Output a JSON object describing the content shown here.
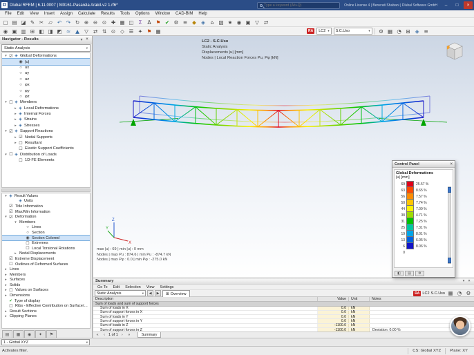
{
  "titlebar": {
    "app_title": "Dlubal RFEM | 6.11.0007 | M0161-Pasarela Arakil-v2 1.rf6*",
    "search_placeholder": "Type a keyword (Alt+Q)",
    "license_text": "Online License 4 | Benerati Shabani | Dlubal Software GmbH",
    "minimize": "–",
    "maximize": "□",
    "close": "×"
  },
  "menubar": {
    "items": [
      {
        "label": "File"
      },
      {
        "label": "Edit"
      },
      {
        "label": "View"
      },
      {
        "label": "Insert"
      },
      {
        "label": "Assign"
      },
      {
        "label": "Calculate"
      },
      {
        "label": "Results"
      },
      {
        "label": "Tools"
      },
      {
        "label": "Options"
      },
      {
        "label": "Window"
      },
      {
        "label": "CAD-BIM"
      },
      {
        "label": "Help"
      }
    ]
  },
  "toolbars": {
    "row1": [
      {
        "g": "▢"
      },
      {
        "g": "▤"
      },
      {
        "g": "◪"
      },
      {
        "g": "✎"
      },
      {
        "g": "✂"
      },
      {
        "g": "▱"
      },
      {
        "g": "↶",
        "c": "#3a6ea5"
      },
      {
        "g": "↷",
        "c": "#3a6ea5"
      },
      {
        "g": "↻"
      },
      {
        "g": "⊕"
      },
      {
        "g": "⊖"
      },
      {
        "g": "⊙"
      },
      {
        "g": "✚"
      },
      {
        "g": "▦"
      },
      {
        "g": "◫"
      },
      {
        "g": "Σ",
        "c": "#7a4aa5"
      },
      {
        "g": "Δ"
      },
      {
        "g": "⚑",
        "c": "#c04000"
      },
      {
        "g": "✔",
        "c": "#1da01d"
      },
      {
        "g": "⚙"
      },
      {
        "g": "≡"
      },
      {
        "g": "◆",
        "c": "#b8860b"
      },
      {
        "g": "◈",
        "c": "#3a6ea5"
      },
      {
        "g": "⌂"
      },
      {
        "g": "▧"
      },
      {
        "g": "★"
      },
      {
        "g": "◉"
      },
      {
        "g": "▣"
      },
      {
        "g": "▽"
      },
      {
        "g": "⇄"
      }
    ],
    "row2": [
      {
        "g": "◉"
      },
      {
        "g": "▣"
      },
      {
        "g": "▥"
      },
      {
        "g": "⊞"
      },
      {
        "g": "◧"
      },
      {
        "g": "◨"
      },
      {
        "g": "◩"
      },
      {
        "g": "≈",
        "c": "#3a6ea5"
      },
      {
        "g": "▲",
        "c": "#3a6ea5"
      },
      {
        "g": "▽"
      },
      {
        "g": "⇄"
      },
      {
        "g": "⇅"
      },
      {
        "g": "⊙"
      },
      {
        "g": "◇"
      },
      {
        "g": "☰"
      },
      {
        "g": "✦"
      },
      {
        "g": "⚑",
        "c": "#c04000"
      },
      {
        "g": "▦"
      }
    ],
    "row2b": [
      {
        "g": "⚙"
      },
      {
        "g": "▦"
      },
      {
        "g": "◔"
      },
      {
        "g": "⊞"
      },
      {
        "g": "◈",
        "c": "#3a6ea5"
      },
      {
        "g": "≡"
      }
    ],
    "load_case": {
      "badge": "RA",
      "code": "LC2",
      "name": "S.C.Uso"
    }
  },
  "navigator": {
    "title": "Navigator - Results",
    "collapse": "▾",
    "close": "×",
    "combo": "Static Analysis",
    "tree1": [
      {
        "pad": "2px",
        "exp": "▾",
        "box": "☑",
        "ic": "◈",
        "label": "Global Deformations"
      },
      {
        "pad": "16px",
        "box": "◉",
        "label": "|u|",
        "cls": "sel"
      },
      {
        "pad": "16px",
        "box": "○",
        "label": "ux"
      },
      {
        "pad": "16px",
        "box": "○",
        "label": "uy"
      },
      {
        "pad": "16px",
        "box": "○",
        "label": "uz"
      },
      {
        "pad": "16px",
        "box": "○",
        "label": "φx"
      },
      {
        "pad": "16px",
        "box": "○",
        "label": "φy"
      },
      {
        "pad": "16px",
        "box": "○",
        "label": "φz"
      },
      {
        "pad": "2px",
        "exp": "▾",
        "box": "☐",
        "ic": "◈",
        "label": "Members"
      },
      {
        "pad": "16px",
        "exp": "▸",
        "ic": "◈",
        "label": "Local Deformations"
      },
      {
        "pad": "16px",
        "exp": "▸",
        "ic": "◈",
        "label": "Internal Forces"
      },
      {
        "pad": "16px",
        "exp": "▸",
        "ic": "◈",
        "label": "Strains"
      },
      {
        "pad": "16px",
        "exp": "▸",
        "ic": "◈",
        "label": "Stresses"
      },
      {
        "pad": "2px",
        "exp": "▾",
        "box": "☑",
        "ic": "◈",
        "label": "Support Reactions"
      },
      {
        "pad": "16px",
        "exp": "▸",
        "box": "☑",
        "label": "Nodal Supports"
      },
      {
        "pad": "16px",
        "exp": "▸",
        "box": "☐",
        "label": "Resultant"
      },
      {
        "pad": "16px",
        "box": "☐",
        "label": "Elastic Support Coefficients"
      },
      {
        "pad": "2px",
        "exp": "▾",
        "box": "☐",
        "ic": "◈",
        "label": "Distribution of Loads"
      },
      {
        "pad": "16px",
        "box": "☐",
        "label": "1D-FE Elements"
      }
    ],
    "tree2": [
      {
        "pad": "2px",
        "exp": "▾",
        "ic": "◈",
        "label": "Result Values"
      },
      {
        "pad": "16px",
        "ic": "◈",
        "label": "Units"
      },
      {
        "pad": "2px",
        "box": "☑",
        "label": "Title Information"
      },
      {
        "pad": "2px",
        "box": "☑",
        "label": "Max/Min Information"
      },
      {
        "pad": "2px",
        "exp": "▾",
        "box": "☑",
        "label": "Deformation"
      },
      {
        "pad": "16px",
        "exp": "▾",
        "label": "Members"
      },
      {
        "pad": "26px",
        "box": "○",
        "label": "Lines"
      },
      {
        "pad": "26px",
        "box": "○",
        "label": "Section"
      },
      {
        "pad": "26px",
        "box": "◉",
        "label": "Section Colored",
        "cls": "sel"
      },
      {
        "pad": "26px",
        "box": "☐",
        "label": "Extremes"
      },
      {
        "pad": "26px",
        "box": "☐",
        "label": "Local Torsional Rotations"
      },
      {
        "pad": "16px",
        "exp": "▸",
        "label": "Nodal Displacements"
      },
      {
        "pad": "2px",
        "box": "☑",
        "label": "Extreme Displacement"
      },
      {
        "pad": "2px",
        "box": "☐",
        "label": "Outlines of Deformed Surfaces"
      },
      {
        "pad": "2px",
        "exp": "▸",
        "label": "Lines"
      },
      {
        "pad": "2px",
        "exp": "▸",
        "label": "Members"
      },
      {
        "pad": "2px",
        "exp": "▸",
        "label": "Surfaces"
      },
      {
        "pad": "2px",
        "exp": "▸",
        "label": "Solids"
      },
      {
        "pad": "2px",
        "exp": "▸",
        "box": "☐",
        "label": "Values on Surfaces"
      },
      {
        "pad": "2px",
        "exp": "▸",
        "label": "Dimensions"
      },
      {
        "pad": "2px",
        "ic": "✔",
        "icc": "#1da01d",
        "label": "Type of display"
      },
      {
        "pad": "2px",
        "box": "☐",
        "label": "Ribs - Effective Contribution on Surface/Member"
      },
      {
        "pad": "2px",
        "exp": "▸",
        "label": "Result Sections"
      },
      {
        "pad": "2px",
        "exp": "▸",
        "label": "Clipping Planes"
      }
    ],
    "tabs": [
      {
        "g": "▤"
      },
      {
        "g": "▦"
      },
      {
        "g": "◉"
      },
      {
        "g": "✦"
      },
      {
        "g": "⚑"
      }
    ]
  },
  "viewport": {
    "info": {
      "line1": "LC2 - S.C.Uso",
      "line2": "Static Analysis",
      "line3": "Displacements |u| [mm]",
      "line4": "Nodes | Local Reaction Forces Pu, Pφ [kN]"
    },
    "results": {
      "line1": "max |u| : 69 | min |u| : 0 mm",
      "line2": "Nodes | max Pu : 874.6 | min Pu : -874.7 kN",
      "line3": "Nodes | max Pφ : 0.0 | min Pφ : -275.0 kN"
    },
    "axes": {
      "x": "X",
      "y": "Y",
      "z": "Z"
    }
  },
  "control_panel": {
    "title": "Control Panel",
    "close": "×",
    "header": "Global Deformations",
    "unit_line": "|u| [mm]",
    "scale": [
      {
        "v": "69",
        "c": "#e1001a",
        "p": "25.57 %"
      },
      {
        "v": "63",
        "c": "#ff4b00",
        "p": "8.65 %"
      },
      {
        "v": "56",
        "c": "#ff8c00",
        "p": "7.57 %"
      },
      {
        "v": "50",
        "c": "#ffc400",
        "p": "7.74 %"
      },
      {
        "v": "44",
        "c": "#fff200",
        "p": "7.09 %"
      },
      {
        "v": "38",
        "c": "#9fdc00",
        "p": "4.71 %"
      },
      {
        "v": "31",
        "c": "#00c300",
        "p": "7.25 %"
      },
      {
        "v": "25",
        "c": "#00c8a0",
        "p": "7.31 %"
      },
      {
        "v": "19",
        "c": "#00a6e8",
        "p": "8.01 %"
      },
      {
        "v": "13",
        "c": "#0064e1",
        "p": "6.05 %"
      },
      {
        "v": "6",
        "c": "#1414c8",
        "p": "8.06 %"
      }
    ],
    "min_value": "0",
    "buttons": [
      {
        "g": "◧"
      },
      {
        "g": "▤"
      },
      {
        "g": "⚙"
      }
    ]
  },
  "summary": {
    "title": "Summary",
    "collapse": "▾",
    "close": "×",
    "menu": [
      {
        "label": "Go To"
      },
      {
        "label": "Edit"
      },
      {
        "label": "Selection"
      },
      {
        "label": "View"
      },
      {
        "label": "Settings"
      }
    ],
    "combo": "Static Analysis",
    "prev": "◀",
    "next": "▶",
    "tab_icon": "⊞",
    "tab": "Overview",
    "case": {
      "badge": "RA",
      "code": "LC2",
      "name": "S.C.Uso"
    },
    "tool_icons": [
      {
        "g": "▦"
      },
      {
        "g": "◔"
      },
      {
        "g": "⚙"
      }
    ],
    "table": {
      "col_desc": "Description",
      "col_value": "Value",
      "col_unit": "Unit",
      "col_notes": "Notes",
      "section": "Sum of loads and sum of support forces",
      "rows": [
        {
          "desc": "Sum of loads in X",
          "value": "0.0",
          "unit": "kN",
          "notes": ""
        },
        {
          "desc": "Sum of support forces in X",
          "value": "0.0",
          "unit": "kN",
          "notes": ""
        },
        {
          "desc": "Sum of loads in Y",
          "value": "0.0",
          "unit": "kN",
          "notes": ""
        },
        {
          "desc": "Sum of support forces in Y",
          "value": "0.0",
          "unit": "kN",
          "notes": ""
        },
        {
          "desc": "Sum of loads in Z",
          "value": "-1100.0",
          "unit": "kN",
          "notes": ""
        },
        {
          "desc": "Sum of support forces in Z",
          "value": "-1100.0",
          "unit": "kN",
          "notes": "Deviation: 0.00 %"
        }
      ]
    },
    "pager": {
      "first": "«",
      "prev": "‹",
      "label": "1 of 1",
      "next": "›",
      "last": "»"
    },
    "bottom_tab": "Summary"
  },
  "bottom_strip": {
    "combo": "1 - Global XYZ"
  },
  "statusbar": {
    "message": "Activates filter.",
    "cs": "CS: Global XYZ",
    "plane": "Plane: XY"
  }
}
